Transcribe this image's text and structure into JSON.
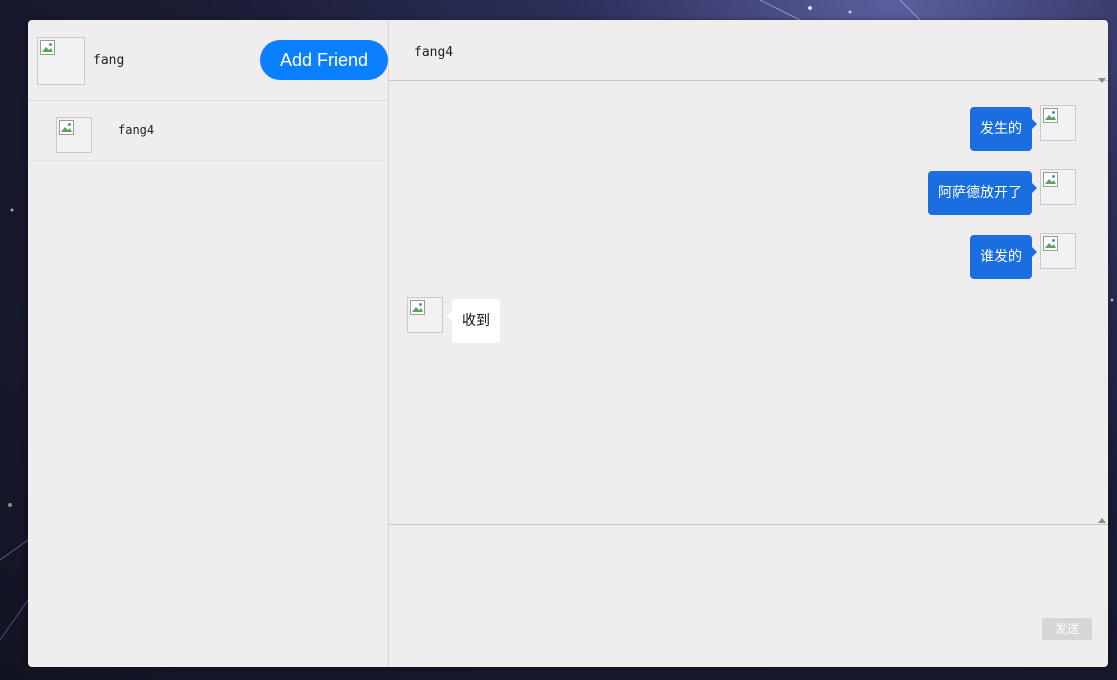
{
  "user": {
    "name": "fang"
  },
  "sidebar": {
    "add_friend_label": "Add Friend",
    "contacts": [
      {
        "name": "fang4"
      }
    ]
  },
  "chat": {
    "title": "fang4",
    "messages": [
      {
        "direction": "out",
        "text": "发生的"
      },
      {
        "direction": "out",
        "text": "阿萨德放开了"
      },
      {
        "direction": "out",
        "text": "谁发的"
      },
      {
        "direction": "in",
        "text": "收到"
      }
    ],
    "send_label": "发送"
  },
  "colors": {
    "accent": "#0a7fff",
    "outgoing_bubble": "#1a6ee0",
    "incoming_bubble": "#ffffff",
    "panel_bg": "#efedee"
  },
  "icons": {
    "broken_image": "broken-image-icon"
  }
}
